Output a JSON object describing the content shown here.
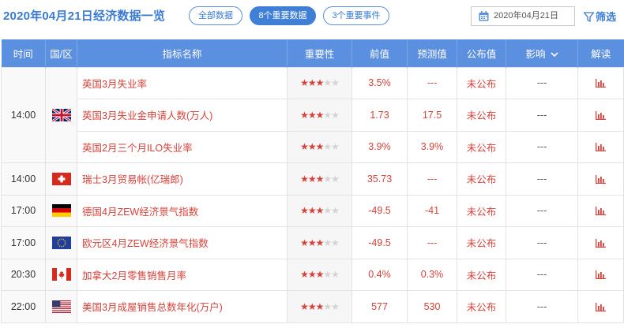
{
  "header": {
    "title": "2020年04月21日经济数据一览",
    "filters": [
      {
        "label": "全部数据",
        "active": false
      },
      {
        "label": "8个重要数据",
        "active": true
      },
      {
        "label": "3个重要事件",
        "active": false
      }
    ],
    "date": "2020年04月21日",
    "filter_label": "筛选"
  },
  "columns": [
    "时间",
    "国/区",
    "指标名称",
    "重要性",
    "前值",
    "预测值",
    "公布值",
    "影响",
    "解读"
  ],
  "rows": [
    {
      "time": "14:00",
      "country": "uk",
      "name": "英国3月失业率",
      "stars": 3,
      "prev": "3.5%",
      "forecast": "---",
      "actual": "未公布",
      "impact": "---"
    },
    {
      "time": "",
      "country": "uk",
      "name": "英国3月失业金申请人数(万人)",
      "stars": 3,
      "prev": "1.73",
      "forecast": "17.5",
      "actual": "未公布",
      "impact": "---"
    },
    {
      "time": "",
      "country": "uk",
      "name": "英国2月三个月ILO失业率",
      "stars": 3,
      "prev": "3.9%",
      "forecast": "3.9%",
      "actual": "未公布",
      "impact": "---"
    },
    {
      "time": "14:00",
      "country": "switzerland",
      "name": "瑞士3月贸易帐(亿瑞郎)",
      "stars": 3,
      "prev": "35.73",
      "forecast": "---",
      "actual": "未公布",
      "impact": "---"
    },
    {
      "time": "17:00",
      "country": "germany",
      "name": "德国4月ZEW经济景气指数",
      "stars": 3,
      "prev": "-49.5",
      "forecast": "-41",
      "actual": "未公布",
      "impact": "---"
    },
    {
      "time": "17:00",
      "country": "eurozone",
      "name": "欧元区4月ZEW经济景气指数",
      "stars": 3,
      "prev": "-49.5",
      "forecast": "---",
      "actual": "未公布",
      "impact": "---"
    },
    {
      "time": "20:30",
      "country": "canada",
      "name": "加拿大2月零售销售月率",
      "stars": 3,
      "prev": "0.4%",
      "forecast": "0.3%",
      "actual": "未公布",
      "impact": "---"
    },
    {
      "time": "22:00",
      "country": "usa",
      "name": "美国3月成屋销售总数年化(万户)",
      "stars": 3,
      "prev": "577",
      "forecast": "530",
      "actual": "未公布",
      "impact": "---"
    }
  ],
  "colors": {
    "accent": "#3a7bd5",
    "header_bg": "#5b8fe0",
    "value_red": "#d8413a"
  }
}
